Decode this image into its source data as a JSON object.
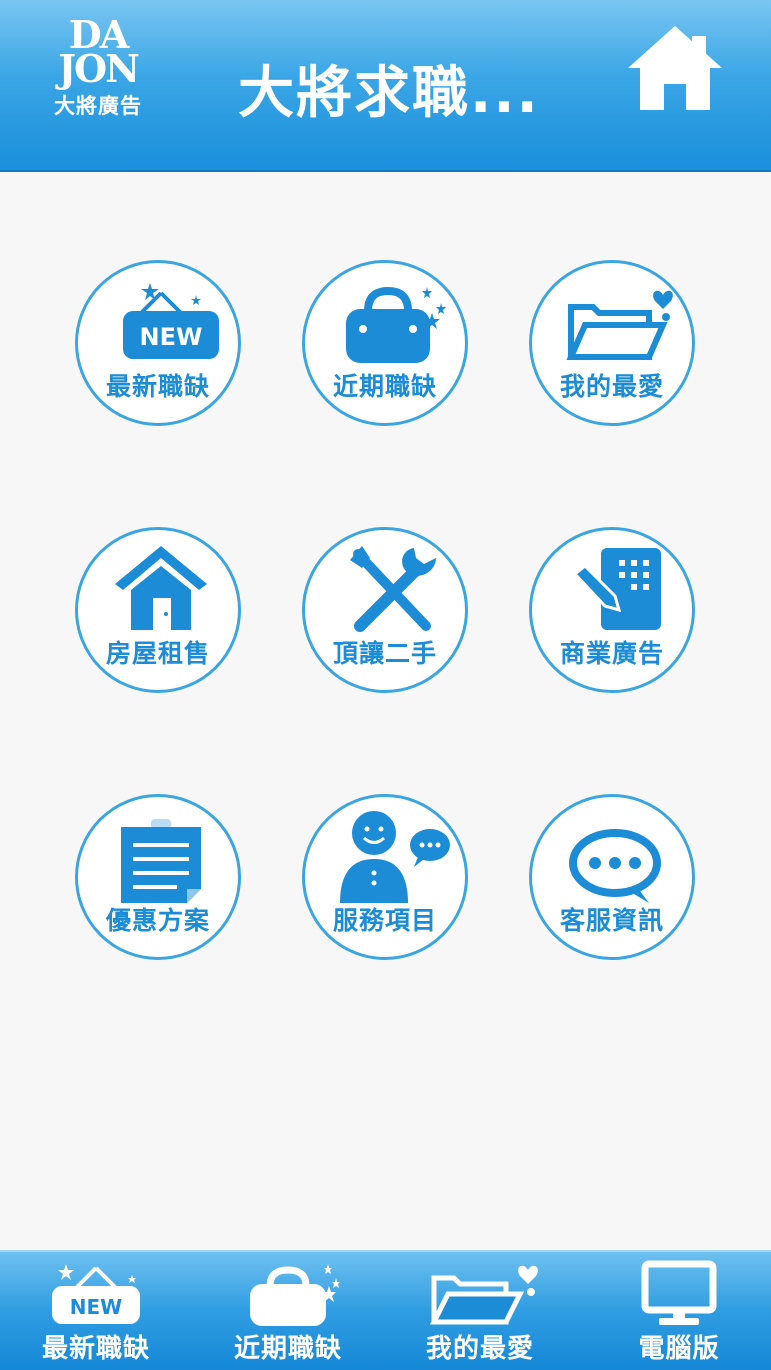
{
  "header": {
    "logo_mark_line1": "DA",
    "logo_mark_line2": "JON",
    "logo_subtitle": "大將廣告",
    "title": "大將求職..."
  },
  "menu": {
    "items": [
      {
        "label": "最新職缺",
        "icon": "new-sign-icon"
      },
      {
        "label": "近期職缺",
        "icon": "bag-icon"
      },
      {
        "label": "我的最愛",
        "icon": "folder-heart-icon"
      },
      {
        "label": "房屋租售",
        "icon": "house-icon"
      },
      {
        "label": "頂讓二手",
        "icon": "tools-icon"
      },
      {
        "label": "商業廣告",
        "icon": "building-icon"
      },
      {
        "label": "優惠方案",
        "icon": "clipboard-icon"
      },
      {
        "label": "服務項目",
        "icon": "person-chat-icon"
      },
      {
        "label": "客服資訊",
        "icon": "chat-bubble-icon"
      }
    ]
  },
  "tabbar": {
    "items": [
      {
        "label": "最新職缺",
        "icon": "new-sign-icon"
      },
      {
        "label": "近期職缺",
        "icon": "bag-icon"
      },
      {
        "label": "我的最愛",
        "icon": "folder-heart-icon"
      },
      {
        "label": "電腦版",
        "icon": "monitor-icon"
      }
    ]
  },
  "colors": {
    "header_blue": "#2a9be3",
    "icon_blue": "#1c8cd6",
    "ring_blue": "#3aa5e0",
    "background": "#f7f7f7",
    "white": "#ffffff"
  }
}
